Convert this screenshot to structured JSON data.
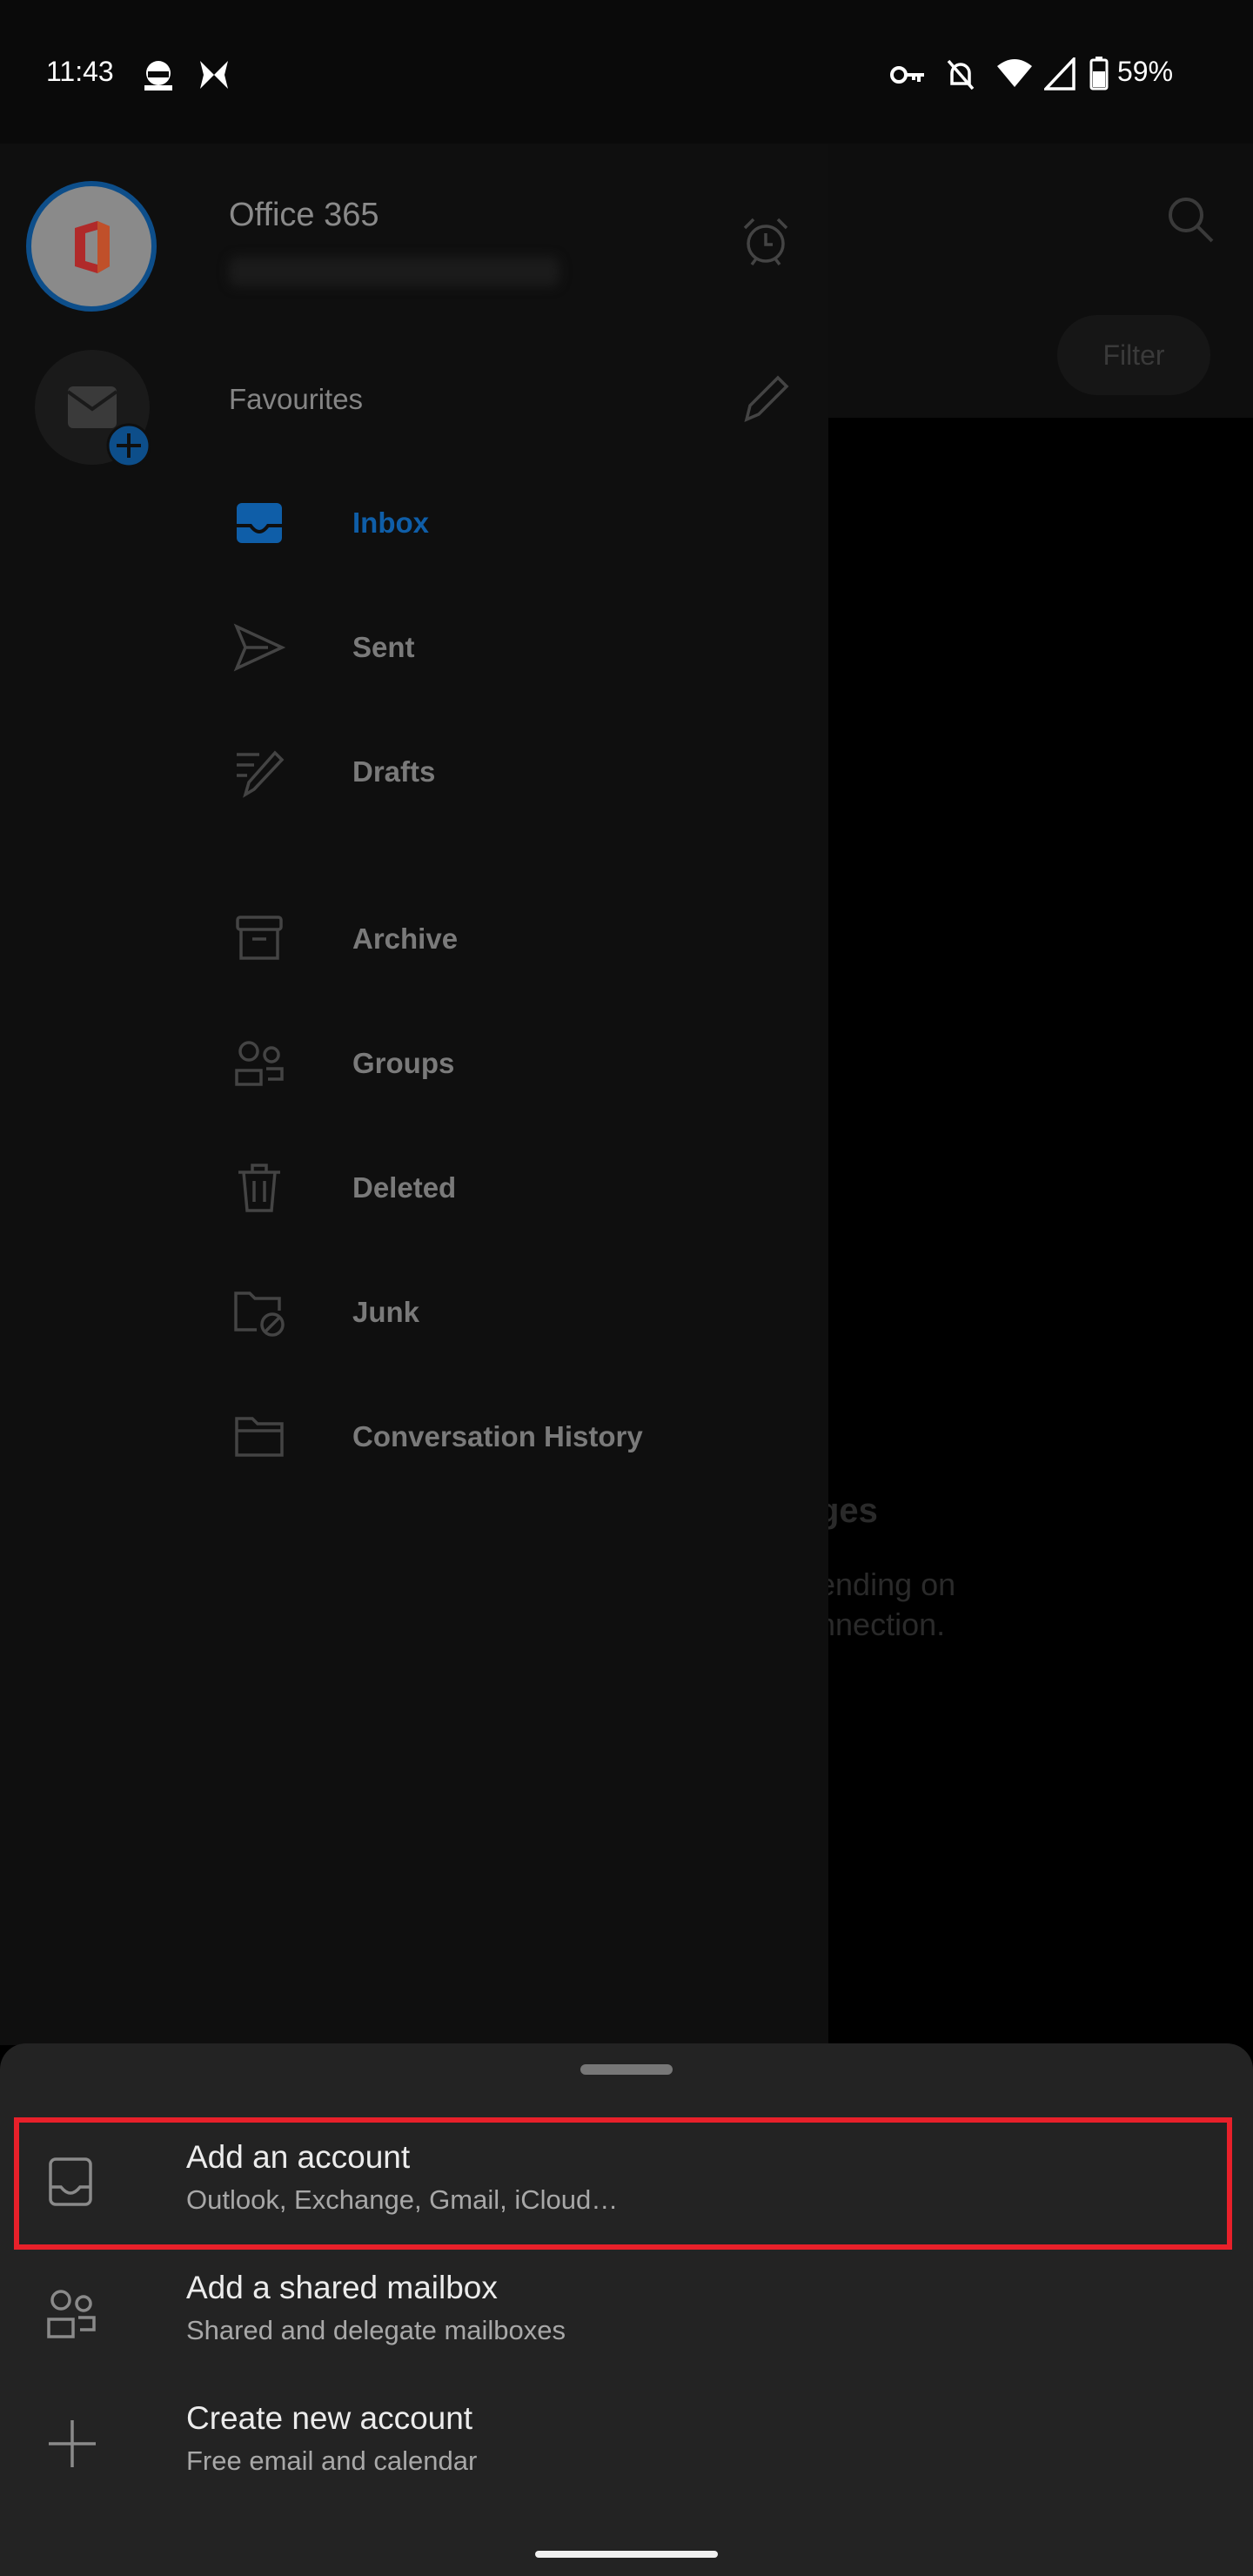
{
  "status_bar": {
    "time": "11:43",
    "battery": "59%",
    "icons": [
      "face-icon",
      "butterfly-icon",
      "vpn-key-icon",
      "bell-off-icon",
      "wifi-icon",
      "signal-icon",
      "battery-icon"
    ]
  },
  "background": {
    "filter_label": "Filter",
    "fragment_1": "ges",
    "fragment_2": "ending on",
    "fragment_3": "nnection."
  },
  "drawer": {
    "account_title": "Office 365",
    "favourites_label": "Favourites",
    "items": [
      {
        "label": "Inbox",
        "icon": "inbox-icon",
        "active": true
      },
      {
        "label": "Sent",
        "icon": "send-icon"
      },
      {
        "label": "Drafts",
        "icon": "drafts-icon"
      },
      {
        "label": "Archive",
        "icon": "archive-icon"
      },
      {
        "label": "Groups",
        "icon": "groups-icon"
      },
      {
        "label": "Deleted",
        "icon": "trash-icon"
      },
      {
        "label": "Junk",
        "icon": "junk-folder-icon"
      },
      {
        "label": "Conversation History",
        "icon": "folder-icon"
      }
    ]
  },
  "sheet": {
    "options": [
      {
        "title": "Add an account",
        "subtitle": "Outlook, Exchange, Gmail, iCloud…",
        "icon": "inbox-tray-icon",
        "highlighted": true
      },
      {
        "title": "Add a shared mailbox",
        "subtitle": "Shared and delegate mailboxes",
        "icon": "people-icon"
      },
      {
        "title": "Create new account",
        "subtitle": "Free email and calendar",
        "icon": "plus-icon"
      }
    ]
  },
  "colors": {
    "accent": "#0f5ea8",
    "highlight": "#e8202a",
    "sheet_bg": "#232323"
  }
}
